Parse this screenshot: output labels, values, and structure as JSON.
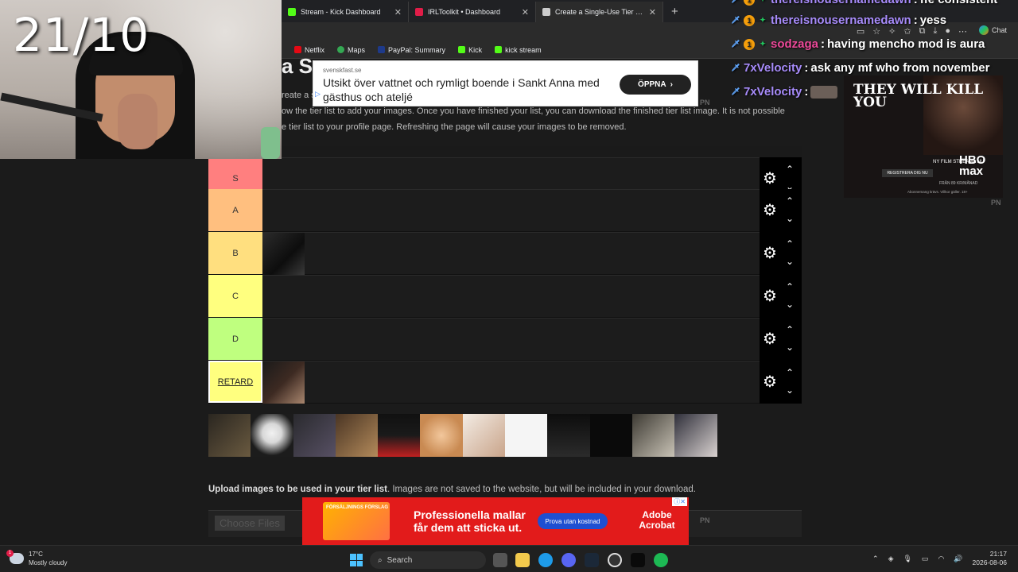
{
  "browser": {
    "tabs": [
      {
        "title": "Stream - Kick Dashboard",
        "favicon_color": "#53fc18",
        "active": false
      },
      {
        "title": "IRLToolkit • Dashboard",
        "favicon_color": "#e11d48",
        "active": false
      },
      {
        "title": "Create a Single-Use Tier List (Priva",
        "favicon_color": "#cccccc",
        "active": true
      }
    ],
    "new_tab": "+",
    "chat_label": "Chat",
    "bookmarks": [
      {
        "label": "Netflix",
        "color": "#e50914"
      },
      {
        "label": "Maps",
        "color": "#34a853"
      },
      {
        "label": "PayPal: Summary",
        "color": "#1e3a8a"
      },
      {
        "label": "Kick",
        "color": "#53fc18"
      },
      {
        "label": "kick stream",
        "color": "#53fc18"
      }
    ]
  },
  "page": {
    "heading_fragment": "a S",
    "intro_lines": [
      "reate a s                                                                                                                                          the website. Use the",
      "ow the tier list to add your images. Once you have finished your list, you can download the finished tier list image. It is not possible",
      "e tier list to your profile page. Refreshing the page will cause your images to be removed."
    ],
    "pn_label": "PN",
    "tiers": [
      {
        "label": "S",
        "color": "#ff7f7f",
        "items": 0
      },
      {
        "label": "A",
        "color": "#ffbf7f",
        "items": 0
      },
      {
        "label": "B",
        "color": "#ffdf7f",
        "items": 1
      },
      {
        "label": "C",
        "color": "#ffff7f",
        "items": 0
      },
      {
        "label": "D",
        "color": "#bfff7f",
        "items": 0
      },
      {
        "label": "RETARD",
        "color": "#ffff7f",
        "items": 1
      }
    ],
    "pool_count": 12,
    "upload_bold": "Upload images to be used in your tier list",
    "upload_rest": ". Images are not saved to the website, but will be included in your download.",
    "choose_files": "Choose Files"
  },
  "ads": {
    "top": {
      "source": "svenskfast.se",
      "text": "Utsikt över vattnet och rymligt boende i Sankt Anna med gästhus och ateljé",
      "button": "ÖPPNA"
    },
    "bottom": {
      "box_text": "FÖRSÄLJNINGS FÖRSLAG",
      "headline": "Professionella mallar får dem att sticka ut.",
      "cta": "Prova utan kostnad",
      "brand": "Adobe Acrobat"
    },
    "side": {
      "title": "THEY WILL KILL YOU",
      "tagline": "NY FILM STREAMA NU",
      "brand": "HBO max",
      "register": "REGISTRERA DIG NU",
      "price": "FRÅN 89 KR/MÅNAD",
      "fine": "Abonnemang krävs. Villkor gäller. 18+"
    }
  },
  "overlay": {
    "score": "21/10",
    "chat": [
      {
        "user": "thereisnousernamedawn",
        "text": "ffe consistent",
        "badges": [
          "sword",
          "coin",
          "gem"
        ]
      },
      {
        "user": "thereisnousernamedawn",
        "text": "yess",
        "badges": [
          "sword",
          "coin",
          "gem"
        ]
      },
      {
        "user": "sodzaga",
        "text": "having mencho mod is aura",
        "badges": [
          "sword",
          "coin",
          "gem"
        ],
        "user_color": "#ec4899"
      },
      {
        "user": "7xVelocity",
        "text": "ask any mf who from november",
        "badges": [
          "sword"
        ],
        "user_color": "#a78bfa"
      },
      {
        "user": "7xVelocity",
        "text": "",
        "badges": [
          "sword"
        ],
        "user_color": "#a78bfa",
        "emote": true
      }
    ]
  },
  "taskbar": {
    "temp": "17°C",
    "weather": "Mostly cloudy",
    "search": "Search",
    "time": "21:17",
    "date": "2026-08-06"
  }
}
